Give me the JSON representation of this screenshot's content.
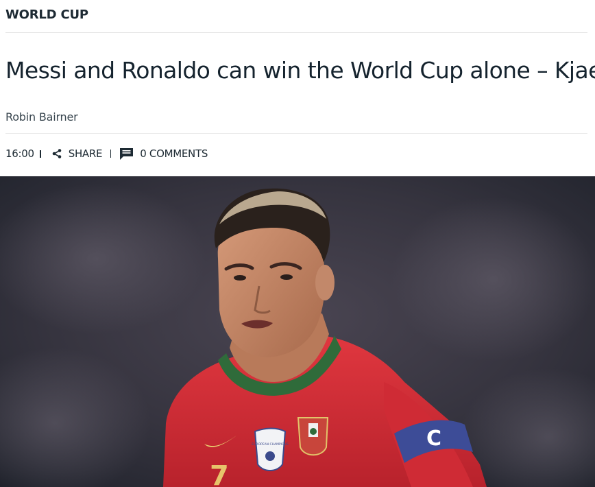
{
  "section": {
    "label": "WORLD CUP"
  },
  "article": {
    "headline": "Messi and Ronaldo can win the World Cup alone – Kjaer",
    "author": "Robin Bairner",
    "time": "16:00",
    "share_label": "SHARE",
    "comments_label": "0 COMMENTS"
  },
  "icons": {
    "share": "share-icon",
    "comments": "comment-icon"
  },
  "hero": {
    "armband_letter": "C",
    "shirt_number": "7",
    "badge_text": "EUROPEAN CHAMPIONS"
  },
  "colors": {
    "text": "#1d2a33",
    "shirt_red": "#d8303a",
    "collar_green": "#2f6b3a",
    "armband_blue": "#3d4c97"
  }
}
